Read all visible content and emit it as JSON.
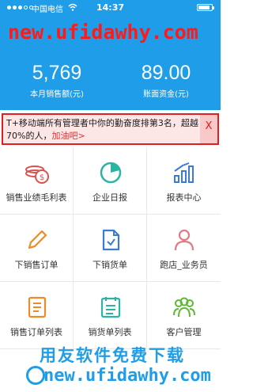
{
  "status_bar": {
    "carrier": "中国电信",
    "time": "14:37"
  },
  "watermark_top": "new.ufidawhy.com",
  "stats": [
    {
      "value": "5,769",
      "label": "本月销售额(元)"
    },
    {
      "value": "89.00",
      "label": "账面资金(元)"
    }
  ],
  "notice": {
    "text": "T+移动端所有管理者中你的勤奋度排第3名，超越70%的人，",
    "link": "加油吧>",
    "close": "X"
  },
  "grid": [
    {
      "label": "销售业绩毛利表",
      "icon": "money-bag-icon",
      "color": "#d9534f"
    },
    {
      "label": "企业日报",
      "icon": "pie-chart-icon",
      "color": "#2bb3a3"
    },
    {
      "label": "报表中心",
      "icon": "bar-chart-icon",
      "color": "#3a7bd5"
    },
    {
      "label": "下销售订单",
      "icon": "pencil-icon",
      "color": "#f08a24"
    },
    {
      "label": "下销货单",
      "icon": "document-icon",
      "color": "#3a7bd5"
    },
    {
      "label": "跑店_业务员",
      "icon": "user-icon",
      "color": "#e07b85"
    },
    {
      "label": "销售订单列表",
      "icon": "list-icon",
      "color": "#f08a24"
    },
    {
      "label": "销货单列表",
      "icon": "list-icon",
      "color": "#2bb3a3"
    },
    {
      "label": "客户管理",
      "icon": "people-icon",
      "color": "#5fb832"
    }
  ],
  "watermark_bottom_cn": "用友软件免费下载",
  "watermark_bottom_en": "new.ufidawhy.com"
}
